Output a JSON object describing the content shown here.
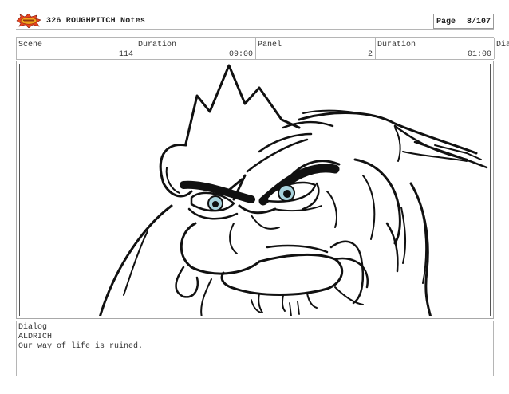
{
  "header": {
    "title": "326 ROUGHPITCH Notes",
    "page_label": "Page",
    "page_value": "8/107"
  },
  "info_fields": [
    {
      "label": "Scene",
      "value": "114"
    },
    {
      "label": "Duration",
      "value": "09:00"
    },
    {
      "label": "Panel",
      "value": "2"
    },
    {
      "label": "Duration",
      "value": "01:00"
    },
    {
      "label": "Dia",
      "value": ""
    }
  ],
  "dialog": {
    "label": "Dialog",
    "character": "ALDRICH",
    "line": "Our way of life is ruined."
  },
  "colors": {
    "logo_fill": "#f2a51c",
    "logo_burst": "#e8431f",
    "eye_iris": "#a9d3dd"
  }
}
